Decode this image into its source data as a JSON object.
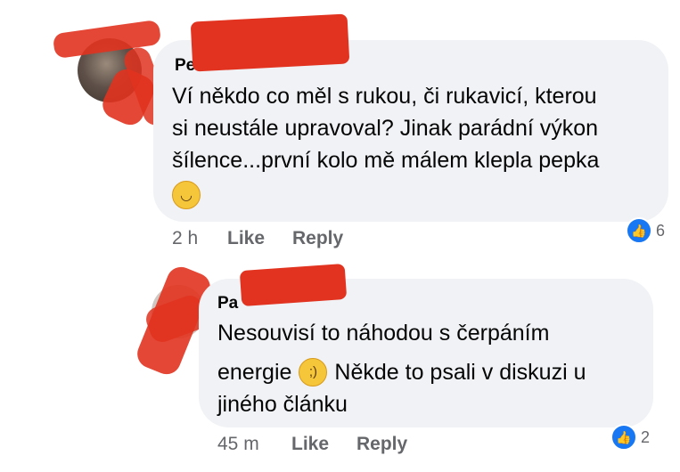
{
  "comments": [
    {
      "author_visible": "Pe",
      "text": "Ví někdo co měl s rukou, či rukavicí, kterou\nsi neustále upravoval? Jinak parádní výkon\nšílence...první kolo mě málem klepla pepka",
      "emoji": "grinning-face",
      "time": "2 h",
      "like_label": "Like",
      "reply_label": "Reply",
      "reaction_count": "6"
    },
    {
      "author_visible": "Pa",
      "text_line1": "Nesouvisí to náhodou s čerpáním",
      "text_line2_a": "energie",
      "emoji": "winking-face",
      "text_line2_b": "Někde to psali v diskuzi u",
      "text_line3": "jiného článku",
      "time": "45 m",
      "like_label": "Like",
      "reply_label": "Reply",
      "reaction_count": "2"
    }
  ],
  "colors": {
    "bubble": "#f0f2f5",
    "meta_text": "#65676b",
    "like_blue": "#1877f2",
    "redaction": "#e1331f"
  }
}
